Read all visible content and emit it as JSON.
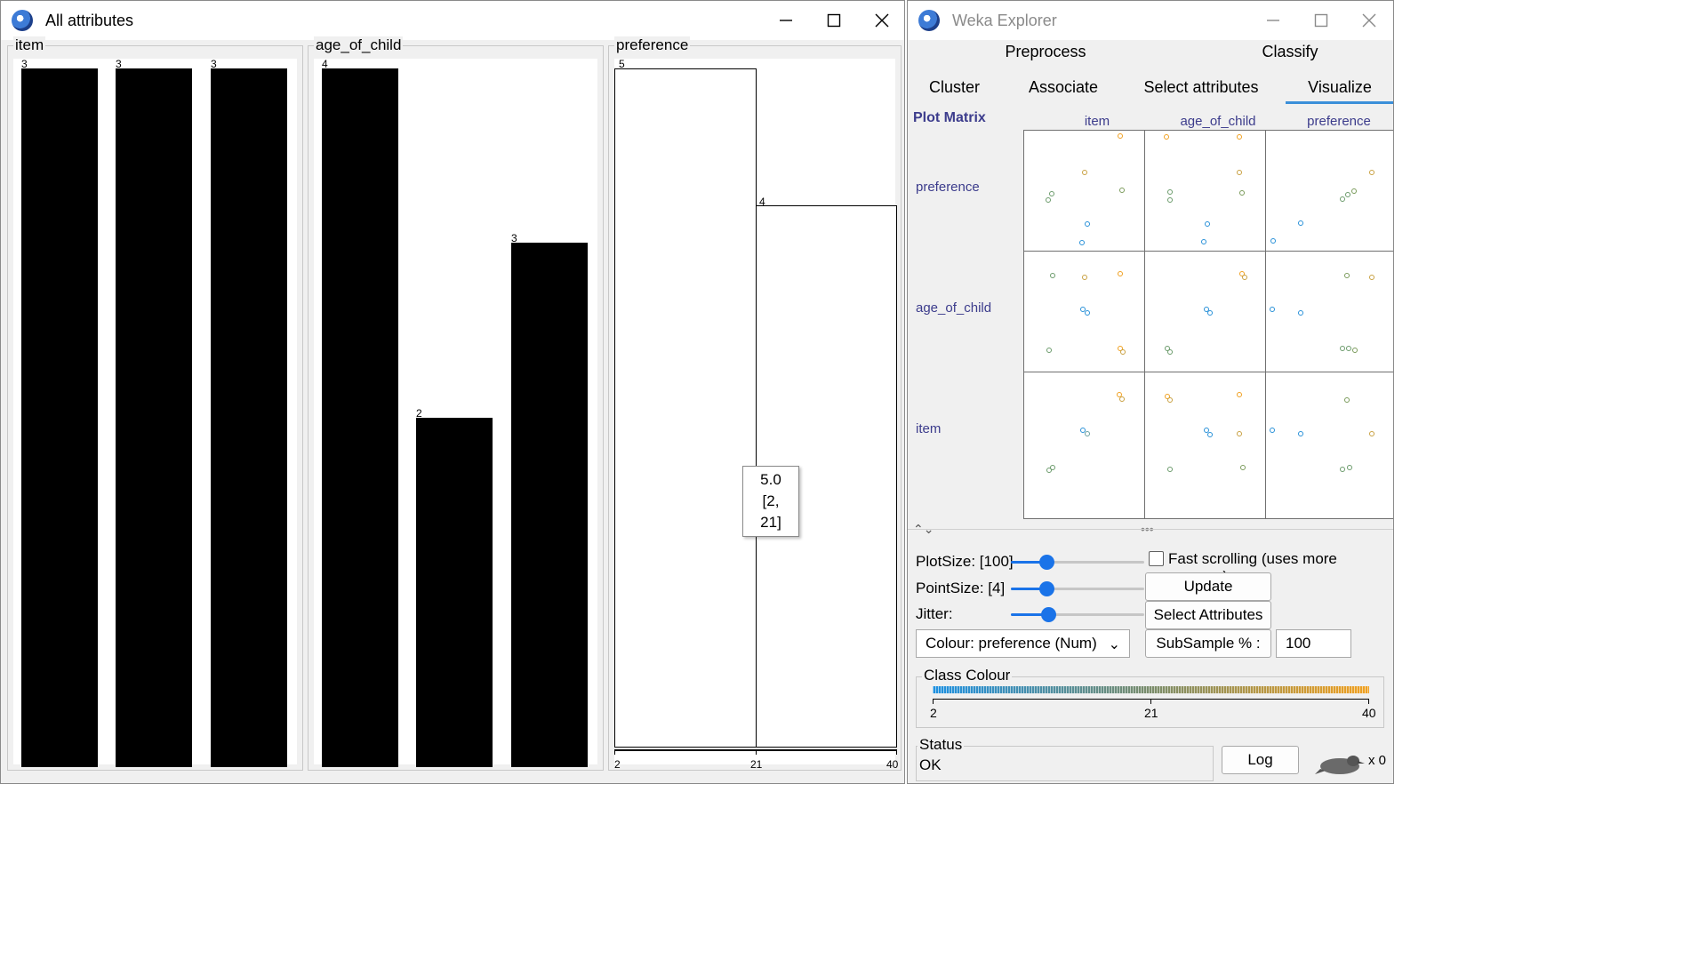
{
  "attributes_window": {
    "title": "All attributes",
    "panels": [
      {
        "name": "item",
        "bars": [
          3,
          3,
          3
        ]
      },
      {
        "name": "age_of_child",
        "bars": [
          4,
          2,
          3
        ]
      },
      {
        "name": "preference",
        "bins": [
          5,
          4
        ],
        "ticks": [
          "2",
          "21",
          "40"
        ]
      }
    ],
    "tooltip": {
      "value": "5.0",
      "range": "[2, 21]"
    }
  },
  "explorer": {
    "title": "Weka Explorer",
    "tabs_row1": [
      "Preprocess",
      "Classify"
    ],
    "tabs_row2": [
      "Cluster",
      "Associate",
      "Select attributes",
      "Visualize"
    ],
    "active_tab": "Visualize",
    "matrix": {
      "title": "Plot Matrix",
      "columns": [
        "item",
        "age_of_child",
        "preference"
      ],
      "rows": [
        "preference",
        "age_of_child",
        "item"
      ]
    },
    "controls": {
      "plot_size_label": "PlotSize: [100]",
      "plot_size_value": 100,
      "point_size_label": "PointSize: [4]",
      "point_size_value": 4,
      "jitter_label": "Jitter:",
      "jitter_value": 0,
      "fast_scrolling_label": "Fast scrolling (uses more memory)",
      "fast_scrolling_checked": false,
      "update_label": "Update",
      "select_attributes_label": "Select Attributes",
      "colour_label": "Colour: preference  (Num)",
      "subsample_label": "SubSample % :",
      "subsample_value": "100"
    },
    "class_colour": {
      "title": "Class Colour",
      "ticks": [
        "2",
        "21",
        "40"
      ],
      "colors": {
        "low": "#1e90e0",
        "mid": "#7a8c6a",
        "high": "#f0a020"
      }
    },
    "status": {
      "title": "Status",
      "text": "OK"
    },
    "log_label": "Log",
    "task_count": "x 0"
  }
}
